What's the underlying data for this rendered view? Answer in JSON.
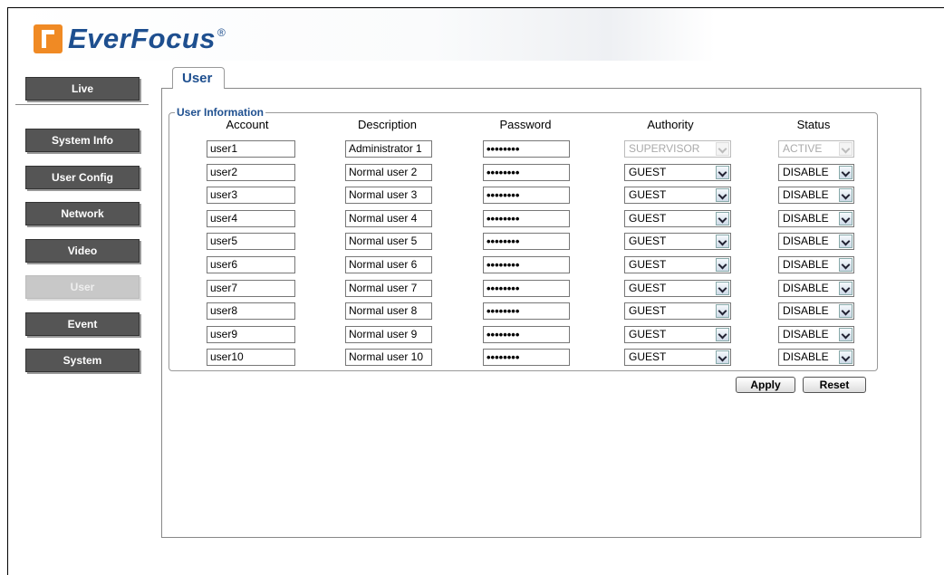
{
  "brand": {
    "name": "EverFocus",
    "reg": "®"
  },
  "nav": [
    {
      "label": "Live"
    },
    {
      "label": "System Info"
    },
    {
      "label": "User Config"
    },
    {
      "label": "Network"
    },
    {
      "label": "Video"
    },
    {
      "label": "User"
    },
    {
      "label": "Event"
    },
    {
      "label": "System"
    }
  ],
  "tab": {
    "label": "User"
  },
  "section": {
    "title": "User Information"
  },
  "columns": {
    "account": "Account",
    "description": "Description",
    "password": "Password",
    "authority": "Authority",
    "status": "Status"
  },
  "users": [
    {
      "account": "user1",
      "description": "Administrator 1",
      "password": "••••••••",
      "authority": "SUPERVISOR",
      "status": "ACTIVE"
    },
    {
      "account": "user2",
      "description": "Normal user 2",
      "password": "••••••••",
      "authority": "GUEST",
      "status": "DISABLE"
    },
    {
      "account": "user3",
      "description": "Normal user 3",
      "password": "••••••••",
      "authority": "GUEST",
      "status": "DISABLE"
    },
    {
      "account": "user4",
      "description": "Normal user 4",
      "password": "••••••••",
      "authority": "GUEST",
      "status": "DISABLE"
    },
    {
      "account": "user5",
      "description": "Normal user 5",
      "password": "••••••••",
      "authority": "GUEST",
      "status": "DISABLE"
    },
    {
      "account": "user6",
      "description": "Normal user 6",
      "password": "••••••••",
      "authority": "GUEST",
      "status": "DISABLE"
    },
    {
      "account": "user7",
      "description": "Normal user 7",
      "password": "••••••••",
      "authority": "GUEST",
      "status": "DISABLE"
    },
    {
      "account": "user8",
      "description": "Normal user 8",
      "password": "••••••••",
      "authority": "GUEST",
      "status": "DISABLE"
    },
    {
      "account": "user9",
      "description": "Normal user 9",
      "password": "••••••••",
      "authority": "GUEST",
      "status": "DISABLE"
    },
    {
      "account": "user10",
      "description": "Normal user 10",
      "password": "••••••••",
      "authority": "GUEST",
      "status": "DISABLE"
    }
  ],
  "buttons": {
    "apply": "Apply",
    "reset": "Reset"
  },
  "colors": {
    "brand_blue": "#1e4f8f",
    "brand_orange": "#f08a24",
    "nav_bg": "#555555",
    "nav_active": "#c8c8c8"
  }
}
